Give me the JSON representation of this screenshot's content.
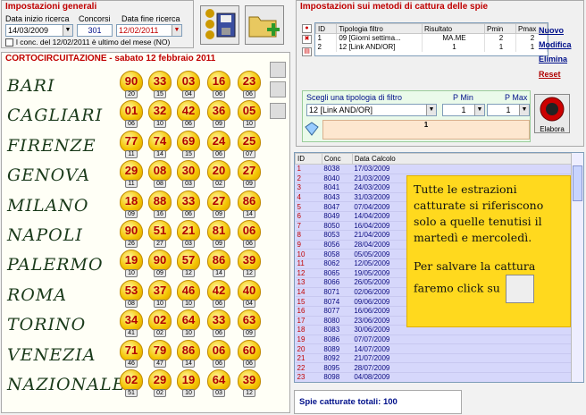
{
  "general": {
    "title": "Impostazioni generali",
    "start_label": "Data inizio ricerca",
    "start_value": "14/03/2009",
    "draws_label": "Concorsi",
    "draws_value": "301",
    "end_label": "Data fine ricerca",
    "end_value": "12/02/2011",
    "checkbox_label": "l conc. del 12/02/2011 è ultimo del mese (NO)"
  },
  "shortcircuit": {
    "title": "CORTOCIRCUITAZIONE - sabato 12 febbraio 2011",
    "wheels": [
      {
        "name": "BARI",
        "nums": [
          "90",
          "33",
          "03",
          "16",
          "23"
        ],
        "sub": [
          "20",
          "15",
          "04",
          "06",
          "06"
        ]
      },
      {
        "name": "CAGLIARI",
        "nums": [
          "01",
          "32",
          "42",
          "36",
          "05"
        ],
        "sub": [
          "06",
          "10",
          "06",
          "09",
          "10"
        ]
      },
      {
        "name": "FIRENZE",
        "nums": [
          "77",
          "74",
          "69",
          "24",
          "25"
        ],
        "sub": [
          "11",
          "14",
          "15",
          "06",
          "07"
        ]
      },
      {
        "name": "GENOVA",
        "nums": [
          "29",
          "08",
          "30",
          "20",
          "27"
        ],
        "sub": [
          "11",
          "08",
          "03",
          "02",
          "09"
        ]
      },
      {
        "name": "MILANO",
        "nums": [
          "18",
          "88",
          "33",
          "27",
          "86"
        ],
        "sub": [
          "09",
          "16",
          "06",
          "09",
          "14"
        ]
      },
      {
        "name": "NAPOLI",
        "nums": [
          "90",
          "51",
          "21",
          "81",
          "06"
        ],
        "sub": [
          "26",
          "27",
          "03",
          "09",
          "06"
        ]
      },
      {
        "name": "PALERMO",
        "nums": [
          "19",
          "90",
          "57",
          "86",
          "39"
        ],
        "sub": [
          "10",
          "09",
          "12",
          "14",
          "12"
        ]
      },
      {
        "name": "ROMA",
        "nums": [
          "53",
          "37",
          "46",
          "42",
          "40"
        ],
        "sub": [
          "08",
          "10",
          "10",
          "06",
          "04"
        ]
      },
      {
        "name": "TORINO",
        "nums": [
          "34",
          "02",
          "64",
          "33",
          "63"
        ],
        "sub": [
          "41",
          "02",
          "10",
          "06",
          "09"
        ]
      },
      {
        "name": "VENEZIA",
        "nums": [
          "71",
          "79",
          "86",
          "06",
          "60"
        ],
        "sub": [
          "46",
          "47",
          "14",
          "06",
          "06"
        ]
      },
      {
        "name": "NAZIONALE",
        "nums": [
          "02",
          "29",
          "19",
          "64",
          "39"
        ],
        "sub": [
          "51",
          "02",
          "10",
          "03",
          "12"
        ]
      }
    ]
  },
  "methods": {
    "title": "Impostazioni sui metodi di cattura delle spie",
    "columns": [
      "ID",
      "Tipologia filtro",
      "Risultato",
      "Pmin",
      "Pmax"
    ],
    "rows": [
      [
        "1",
        "09 [Giorni settima...",
        "MA.ME",
        "2",
        "2"
      ],
      [
        "2",
        "12 [Link AND/OR]",
        "1",
        "1",
        "1"
      ]
    ],
    "links": {
      "new": "Nuovo",
      "edit": "Modifica",
      "delete": "Elimina",
      "reset": "Reset"
    },
    "filter_label": "Scegli una tipologia di filtro",
    "filter_value": "12 [Link AND/OR]",
    "pmin_label": "P Min",
    "pmin_value": "1",
    "pmax_label": "P Max",
    "pmax_value": "1",
    "panel_value": "1",
    "elabora": "Elabora"
  },
  "list": {
    "columns": [
      "ID",
      "Conc",
      "Data Calcolo"
    ],
    "rows": [
      [
        "1",
        "8038",
        "17/03/2009"
      ],
      [
        "2",
        "8040",
        "21/03/2009"
      ],
      [
        "3",
        "8041",
        "24/03/2009"
      ],
      [
        "4",
        "8043",
        "31/03/2009"
      ],
      [
        "5",
        "8047",
        "07/04/2009"
      ],
      [
        "6",
        "8049",
        "14/04/2009"
      ],
      [
        "7",
        "8050",
        "16/04/2009"
      ],
      [
        "8",
        "8053",
        "21/04/2009"
      ],
      [
        "9",
        "8056",
        "28/04/2009"
      ],
      [
        "10",
        "8058",
        "05/05/2009"
      ],
      [
        "11",
        "8062",
        "12/05/2009"
      ],
      [
        "12",
        "8065",
        "19/05/2009"
      ],
      [
        "13",
        "8066",
        "26/05/2009"
      ],
      [
        "14",
        "8071",
        "02/06/2009"
      ],
      [
        "15",
        "8074",
        "09/06/2009"
      ],
      [
        "16",
        "8077",
        "16/06/2009"
      ],
      [
        "17",
        "8080",
        "23/06/2009"
      ],
      [
        "18",
        "8083",
        "30/06/2009"
      ],
      [
        "19",
        "8086",
        "07/07/2009"
      ],
      [
        "20",
        "8089",
        "14/07/2009"
      ],
      [
        "21",
        "8092",
        "21/07/2009"
      ],
      [
        "22",
        "8095",
        "28/07/2009"
      ],
      [
        "23",
        "8098",
        "04/08/2009"
      ],
      [
        "24",
        "8101",
        "11/08/2009"
      ],
      [
        "25",
        "8104",
        "18/08/2009"
      ]
    ]
  },
  "note": {
    "line1": "Tutte le estrazioni catturate si riferiscono solo a quelle tenutisi il martedì e mercoledì.",
    "line2": "Per salvare la cattura faremo click su"
  },
  "footer": {
    "label": "Spie catturate totali: 100"
  }
}
